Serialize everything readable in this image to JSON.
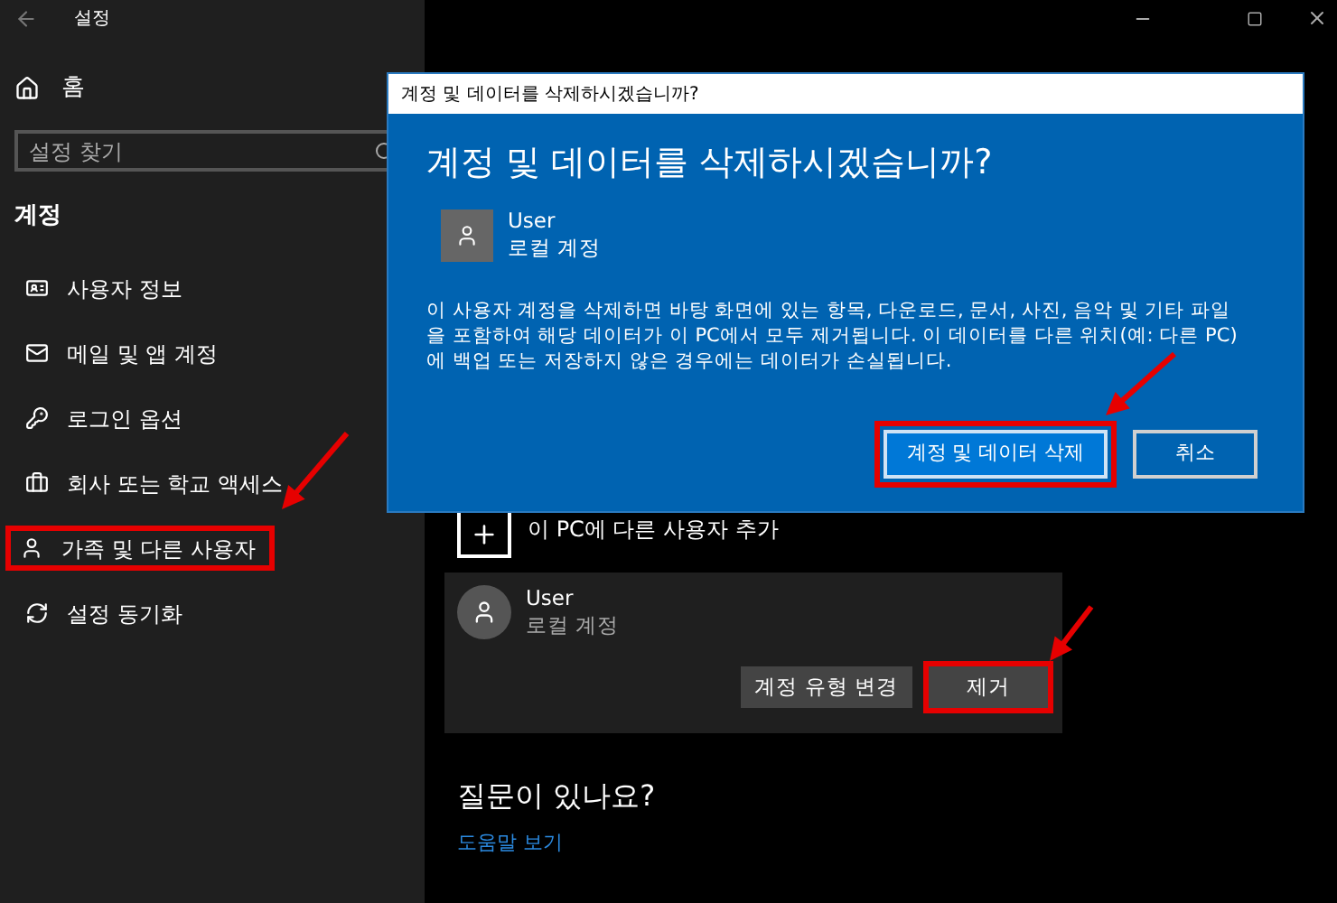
{
  "window": {
    "title": "설정"
  },
  "sidebar": {
    "home": "홈",
    "search": {
      "placeholder": "설정 찾기"
    },
    "section": "계정",
    "items": [
      {
        "label": "사용자 정보",
        "kind": "info",
        "annotated": false
      },
      {
        "label": "메일 및 앱 계정",
        "kind": "mail",
        "annotated": false
      },
      {
        "label": "로그인 옵션",
        "kind": "key",
        "annotated": false
      },
      {
        "label": "회사 또는 학교 액세스",
        "kind": "briefcase",
        "annotated": false
      },
      {
        "label": "가족 및 다른 사용자",
        "kind": "person",
        "annotated": true
      },
      {
        "label": "설정 동기화",
        "kind": "sync",
        "annotated": false
      }
    ]
  },
  "main": {
    "add_user": "이 PC에 다른 사용자 추가",
    "account": {
      "name": "User",
      "type": "로컬 계정",
      "buttons": [
        {
          "label": "계정 유형 변경",
          "annotated": false
        },
        {
          "label": "제거",
          "annotated": true
        }
      ]
    },
    "help": {
      "heading": "질문이 있나요?",
      "link": "도움말 보기"
    }
  },
  "dialog": {
    "title": "계정 및 데이터를 삭제하시겠습니까?",
    "heading": "계정 및 데이터를 삭제하시겠습니까?",
    "user": {
      "name": "User",
      "type": "로컬 계정"
    },
    "message": "이 사용자 계정을 삭제하면 바탕 화면에 있는 항목, 다운로드, 문서, 사진, 음악 및 기타 파일을 포함하여 해당 데이터가 이 PC에서 모두 제거됩니다. 이 데이터를 다른 위치(예: 다른 PC)에 백업 또는 저장하지 않은 경우에는 데이터가 손실됩니다.",
    "buttons": [
      {
        "label": "계정 및 데이터 삭제",
        "primary": true,
        "annotated": true
      },
      {
        "label": "취소",
        "primary": false,
        "annotated": false
      }
    ]
  }
}
